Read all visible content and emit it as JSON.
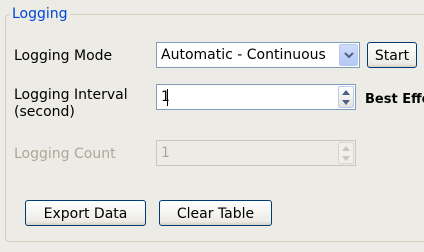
{
  "group": {
    "title": "Logging"
  },
  "logging_mode": {
    "label": "Logging Mode",
    "selected": "Automatic - Continuous",
    "start_label": "Start"
  },
  "logging_interval": {
    "label_line1": "Logging Interval",
    "label_line2": "(second)",
    "value": "1",
    "note": "Best Effort"
  },
  "logging_count": {
    "label": "Logging Count",
    "value": "1",
    "enabled": false
  },
  "actions": {
    "export_label": "Export Data",
    "clear_label": "Clear Table"
  },
  "colors": {
    "legend": "#0046d5",
    "disabled_text": "#aca899",
    "field_border": "#7f9db9",
    "button_border": "#003c74"
  },
  "icons": {
    "combo_arrow": "chevron-down-icon",
    "spin_up": "spin-up-icon",
    "spin_down": "spin-down-icon"
  }
}
